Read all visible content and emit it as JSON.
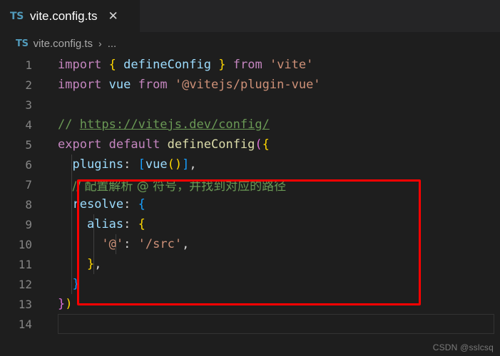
{
  "window": {
    "background": "#1e1e1e",
    "tabbar_background": "#252526"
  },
  "tabbar": {
    "tabs": [
      {
        "icon": "ts-file-icon",
        "icon_label": "TS",
        "label": "vite.config.ts",
        "close_label": "✕",
        "active": true
      }
    ]
  },
  "breadcrumb": {
    "icon_label": "TS",
    "file": "vite.config.ts",
    "separator": "›",
    "overflow": "..."
  },
  "editor": {
    "language": "typescript",
    "active_line": 14,
    "lines": [
      {
        "number": "1",
        "text": "import { defineConfig } from 'vite'"
      },
      {
        "number": "2",
        "text": "import vue from '@vitejs/plugin-vue'"
      },
      {
        "number": "3",
        "text": ""
      },
      {
        "number": "4",
        "text": "// https://vitejs.dev/config/"
      },
      {
        "number": "5",
        "text": "export default defineConfig({"
      },
      {
        "number": "6",
        "text": "  plugins: [vue()],"
      },
      {
        "number": "7",
        "text": "  // 配置解析 @ 符号，并找到对应的路径"
      },
      {
        "number": "8",
        "text": "  resolve: {"
      },
      {
        "number": "9",
        "text": "    alias: {"
      },
      {
        "number": "10",
        "text": "      '@': '/src',"
      },
      {
        "number": "11",
        "text": "    },"
      },
      {
        "number": "12",
        "text": "  }"
      },
      {
        "number": "13",
        "text": "})"
      },
      {
        "number": "14",
        "text": ""
      }
    ],
    "comment_line_4_prefix": "// ",
    "comment_line_4_url": "https://vitejs.dev/config/",
    "comment_line_7": "// 配置解析 @ 符号，并找到对应的路径"
  },
  "tokens": {
    "l1": {
      "kw_import": "import",
      "b1_open": "{",
      "var_defineConfig": "defineConfig",
      "b1_close": "}",
      "kw_from": "from",
      "str": "'vite'"
    },
    "l2": {
      "kw_import": "import",
      "var_vue": "vue",
      "kw_from": "from",
      "str": "'@vitejs/plugin-vue'"
    },
    "l5": {
      "kw_export": "export",
      "kw_default": "default",
      "fn": "defineConfig",
      "b2_paren": "(",
      "b1_brace": "{"
    },
    "l6": {
      "prop": "plugins",
      "colon": ":",
      "b3_bracket": "[",
      "fn_vue": "vue",
      "b1_paren": "()",
      "b3_bracket_close": "]",
      "comma": ","
    },
    "l8": {
      "prop": "resolve",
      "colon": ":",
      "b3_brace": "{"
    },
    "l9": {
      "prop": "alias",
      "colon": ":",
      "b1_brace": "{"
    },
    "l10": {
      "key": "'@'",
      "colon": ":",
      "val": "'/src'",
      "comma": ","
    },
    "l11": {
      "b1_brace": "}",
      "comma": ","
    },
    "l12": {
      "b3_brace": "}"
    },
    "l13": {
      "b2_brace": "}",
      "b1_paren": ")"
    }
  },
  "annotation": {
    "shape": "rectangle",
    "color": "#ff0000",
    "covers_lines": "7-12"
  },
  "watermark": {
    "text": "CSDN @sslcsq"
  }
}
